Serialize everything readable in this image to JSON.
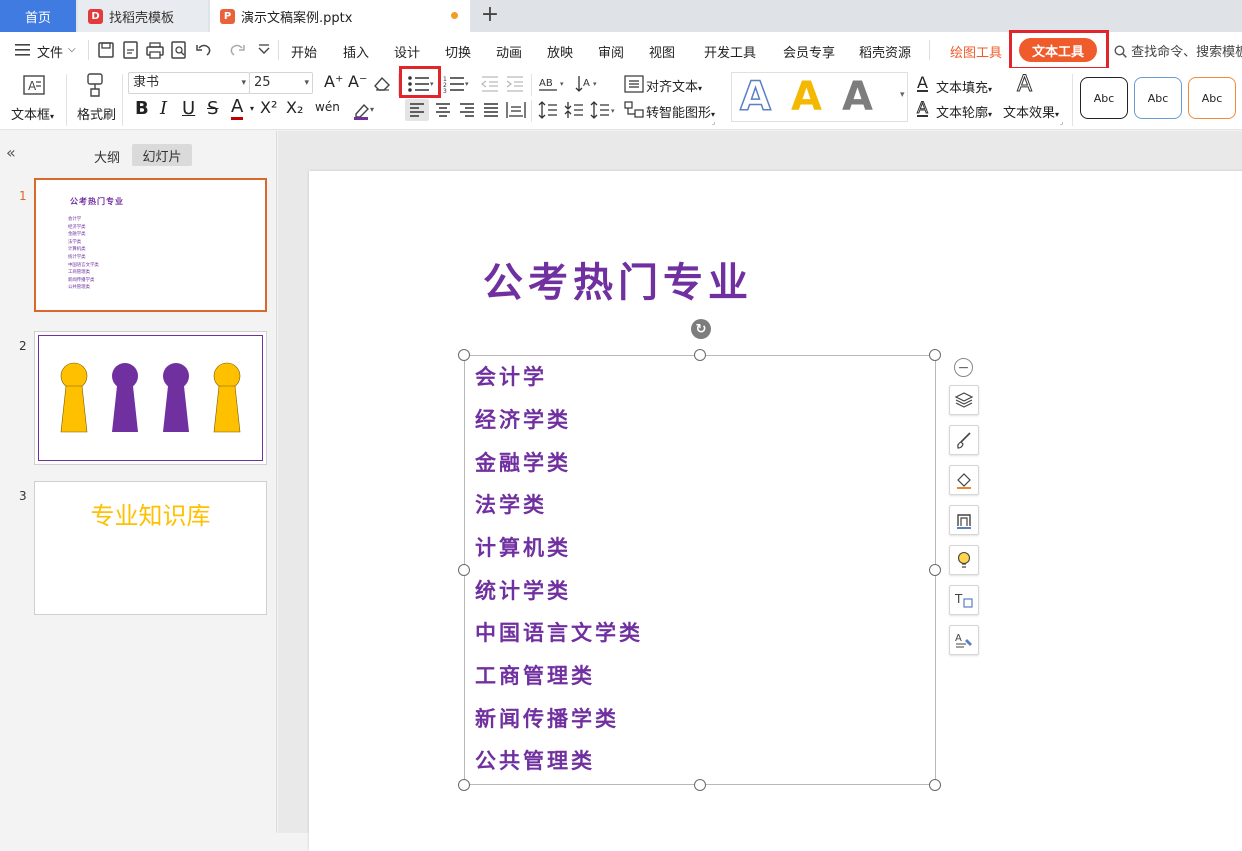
{
  "tabs": {
    "home": "首页",
    "templates": "找稻壳模板",
    "document": "演示文稿案例.pptx",
    "add": "+"
  },
  "menu": {
    "file": "文件",
    "items": [
      "开始",
      "插入",
      "设计",
      "切换",
      "动画",
      "放映",
      "审阅",
      "视图",
      "开发工具",
      "会员专享",
      "稻壳资源"
    ],
    "drawing_tools": "绘图工具",
    "text_tools": "文本工具",
    "search": "查找命令、搜索模板"
  },
  "ribbon": {
    "textbox": "文本框",
    "format_painter": "格式刷",
    "font_name": "隶书",
    "font_size": "25",
    "align_text": "对齐文本",
    "smart_art": "转智能图形",
    "text_fill": "文本填充",
    "text_outline": "文本轮廓",
    "text_effect": "文本效果",
    "style_sample": "Abc",
    "style_A": "A",
    "bold": "B",
    "italic": "I",
    "underline": "U",
    "strike": "S",
    "font_color": "A",
    "superscript": "X²",
    "subscript": "X₂",
    "phonetic": "wén",
    "grow": "A⁺",
    "shrink": "A⁻"
  },
  "panel": {
    "outline_tab": "大纲",
    "slides_tab": "幻灯片",
    "slide_numbers": [
      "1",
      "2",
      "3"
    ],
    "thumb1_title": "公考热门专业",
    "thumb3_title": "专业知识库"
  },
  "slide": {
    "title": "公考热门专业",
    "items": [
      "会计学",
      "经济学类",
      "金融学类",
      "法学类",
      "计算机类",
      "统计学类",
      "中国语言文学类",
      "工商管理类",
      "新闻传播学类",
      "公共管理类"
    ]
  },
  "colors": {
    "accent_purple": "#7030a0",
    "accent_gold": "#ffc000",
    "highlight_red": "#e0262b",
    "tab_blue": "#3f7be0",
    "pill_orange": "#ef5b2b"
  }
}
